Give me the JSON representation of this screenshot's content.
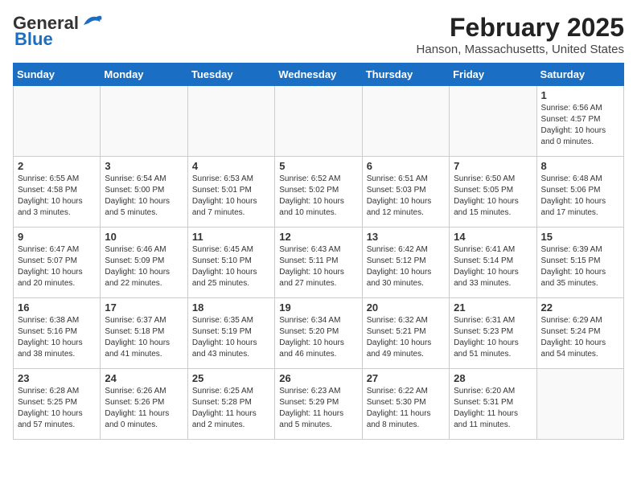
{
  "logo": {
    "line1": "General",
    "line2": "Blue"
  },
  "title": "February 2025",
  "subtitle": "Hanson, Massachusetts, United States",
  "weekdays": [
    "Sunday",
    "Monday",
    "Tuesday",
    "Wednesday",
    "Thursday",
    "Friday",
    "Saturday"
  ],
  "weeks": [
    [
      {
        "day": "",
        "info": ""
      },
      {
        "day": "",
        "info": ""
      },
      {
        "day": "",
        "info": ""
      },
      {
        "day": "",
        "info": ""
      },
      {
        "day": "",
        "info": ""
      },
      {
        "day": "",
        "info": ""
      },
      {
        "day": "1",
        "info": "Sunrise: 6:56 AM\nSunset: 4:57 PM\nDaylight: 10 hours\nand 0 minutes."
      }
    ],
    [
      {
        "day": "2",
        "info": "Sunrise: 6:55 AM\nSunset: 4:58 PM\nDaylight: 10 hours\nand 3 minutes."
      },
      {
        "day": "3",
        "info": "Sunrise: 6:54 AM\nSunset: 5:00 PM\nDaylight: 10 hours\nand 5 minutes."
      },
      {
        "day": "4",
        "info": "Sunrise: 6:53 AM\nSunset: 5:01 PM\nDaylight: 10 hours\nand 7 minutes."
      },
      {
        "day": "5",
        "info": "Sunrise: 6:52 AM\nSunset: 5:02 PM\nDaylight: 10 hours\nand 10 minutes."
      },
      {
        "day": "6",
        "info": "Sunrise: 6:51 AM\nSunset: 5:03 PM\nDaylight: 10 hours\nand 12 minutes."
      },
      {
        "day": "7",
        "info": "Sunrise: 6:50 AM\nSunset: 5:05 PM\nDaylight: 10 hours\nand 15 minutes."
      },
      {
        "day": "8",
        "info": "Sunrise: 6:48 AM\nSunset: 5:06 PM\nDaylight: 10 hours\nand 17 minutes."
      }
    ],
    [
      {
        "day": "9",
        "info": "Sunrise: 6:47 AM\nSunset: 5:07 PM\nDaylight: 10 hours\nand 20 minutes."
      },
      {
        "day": "10",
        "info": "Sunrise: 6:46 AM\nSunset: 5:09 PM\nDaylight: 10 hours\nand 22 minutes."
      },
      {
        "day": "11",
        "info": "Sunrise: 6:45 AM\nSunset: 5:10 PM\nDaylight: 10 hours\nand 25 minutes."
      },
      {
        "day": "12",
        "info": "Sunrise: 6:43 AM\nSunset: 5:11 PM\nDaylight: 10 hours\nand 27 minutes."
      },
      {
        "day": "13",
        "info": "Sunrise: 6:42 AM\nSunset: 5:12 PM\nDaylight: 10 hours\nand 30 minutes."
      },
      {
        "day": "14",
        "info": "Sunrise: 6:41 AM\nSunset: 5:14 PM\nDaylight: 10 hours\nand 33 minutes."
      },
      {
        "day": "15",
        "info": "Sunrise: 6:39 AM\nSunset: 5:15 PM\nDaylight: 10 hours\nand 35 minutes."
      }
    ],
    [
      {
        "day": "16",
        "info": "Sunrise: 6:38 AM\nSunset: 5:16 PM\nDaylight: 10 hours\nand 38 minutes."
      },
      {
        "day": "17",
        "info": "Sunrise: 6:37 AM\nSunset: 5:18 PM\nDaylight: 10 hours\nand 41 minutes."
      },
      {
        "day": "18",
        "info": "Sunrise: 6:35 AM\nSunset: 5:19 PM\nDaylight: 10 hours\nand 43 minutes."
      },
      {
        "day": "19",
        "info": "Sunrise: 6:34 AM\nSunset: 5:20 PM\nDaylight: 10 hours\nand 46 minutes."
      },
      {
        "day": "20",
        "info": "Sunrise: 6:32 AM\nSunset: 5:21 PM\nDaylight: 10 hours\nand 49 minutes."
      },
      {
        "day": "21",
        "info": "Sunrise: 6:31 AM\nSunset: 5:23 PM\nDaylight: 10 hours\nand 51 minutes."
      },
      {
        "day": "22",
        "info": "Sunrise: 6:29 AM\nSunset: 5:24 PM\nDaylight: 10 hours\nand 54 minutes."
      }
    ],
    [
      {
        "day": "23",
        "info": "Sunrise: 6:28 AM\nSunset: 5:25 PM\nDaylight: 10 hours\nand 57 minutes."
      },
      {
        "day": "24",
        "info": "Sunrise: 6:26 AM\nSunset: 5:26 PM\nDaylight: 11 hours\nand 0 minutes."
      },
      {
        "day": "25",
        "info": "Sunrise: 6:25 AM\nSunset: 5:28 PM\nDaylight: 11 hours\nand 2 minutes."
      },
      {
        "day": "26",
        "info": "Sunrise: 6:23 AM\nSunset: 5:29 PM\nDaylight: 11 hours\nand 5 minutes."
      },
      {
        "day": "27",
        "info": "Sunrise: 6:22 AM\nSunset: 5:30 PM\nDaylight: 11 hours\nand 8 minutes."
      },
      {
        "day": "28",
        "info": "Sunrise: 6:20 AM\nSunset: 5:31 PM\nDaylight: 11 hours\nand 11 minutes."
      },
      {
        "day": "",
        "info": ""
      }
    ]
  ]
}
